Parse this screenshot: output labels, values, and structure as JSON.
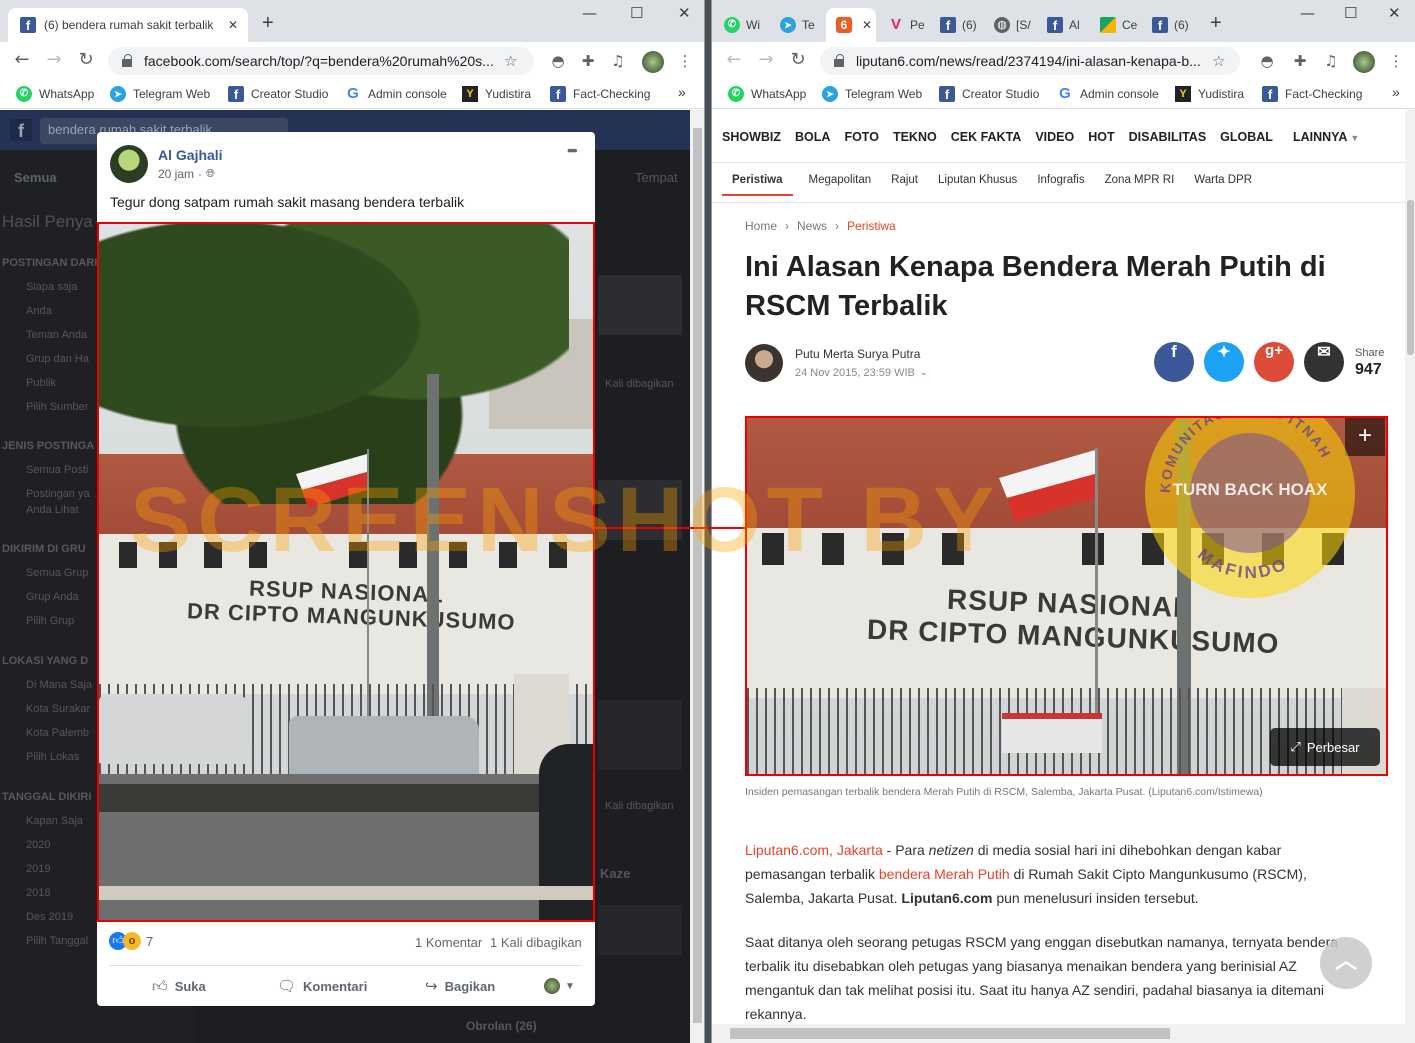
{
  "left_window": {
    "tab": {
      "title": "(6) bendera rumah sakit terbalik",
      "close": "✕"
    },
    "new_tab": "+",
    "window_controls": [
      "—",
      "☐",
      "✕"
    ],
    "url": "facebook.com/search/top/?q=bendera%20rumah%20s...",
    "bookmarks": [
      "WhatsApp",
      "Telegram Web",
      "Creator Studio",
      "Admin console",
      "Yudistira",
      "Fact-Checking"
    ],
    "bookmarks_more": "»",
    "fb_search_text": "bendera rumah sakit terbalik",
    "fb_tab_all": "Semua",
    "fb_places": "Tempat",
    "fb_results_title": "Hasil Penya",
    "fb_sidebar": [
      "POSTINGAN DARI",
      "Siapa saja",
      "Anda",
      "Teman Anda",
      "Grup dan Ha",
      "Publik",
      "Pilih Sumber",
      "JENIS POSTINGA",
      "Semua Posti",
      "Postingan ya",
      "Anda Lihat",
      "DIKIRIM DI GRU",
      "Semua Grup",
      "Grup Anda",
      "Pilih Grup",
      "LOKASI YANG D",
      "Di Mana Saja",
      "Kota Surakar",
      "Kota Palemb",
      "Pilih Lokas",
      "TANGGAL DIKIRI",
      "Kapan Saja",
      "2020",
      "2019",
      "2018",
      "Des 2019",
      "Pilih Tanggal"
    ],
    "fb_right_snippets": [
      "Kali dibagikan",
      "Kali dibagikan",
      "Kaze",
      "Obrolan (26)"
    ],
    "post": {
      "author": "Al Gajhali",
      "time": "20 jam",
      "text": "Tegur dong satpam rumah sakit masang bendera terbalik",
      "reaction_count": "7",
      "comments": "1 Komentar",
      "shares": "1 Kali dibagikan",
      "like_label": "Suka",
      "comment_label": "Komentari",
      "share_label": "Bagikan",
      "menu": "•••"
    }
  },
  "right_window": {
    "tabs": [
      "Wi",
      "Te",
      "Pe",
      "(6)",
      "[S/",
      "Al",
      "Ce",
      "(6)"
    ],
    "close": "✕",
    "new_tab": "+",
    "window_controls": [
      "—",
      "☐",
      "✕"
    ],
    "url": "liputan6.com/news/read/2374194/ini-alasan-kenapa-b...",
    "bookmarks": [
      "WhatsApp",
      "Telegram Web",
      "Creator Studio",
      "Admin console",
      "Yudistira",
      "Fact-Checking"
    ],
    "bookmarks_more": "»",
    "nav_main": [
      "SHOWBIZ",
      "BOLA",
      "FOTO",
      "TEKNO",
      "CEK FAKTA",
      "VIDEO",
      "HOT",
      "DISABILITAS",
      "GLOBAL",
      "LAINNYA"
    ],
    "nav_sub": [
      "Peristiwa",
      "Megapolitan",
      "Rajut",
      "Liputan Khusus",
      "Infografis",
      "Zona MPR RI",
      "Warta DPR"
    ],
    "breadcrumb": [
      "Home",
      "News",
      "Peristiwa"
    ],
    "headline_line1": "Ini Alasan Kenapa Bendera Merah Putih di",
    "headline_line2": "RSCM Terbalik",
    "author": "Putu Merta Surya Putra",
    "date": "24 Nov 2015, 23:59 WIB",
    "share_label": "Share",
    "share_count": "947",
    "photo_enlarge": "Perbesar",
    "caption": "Insiden pemasangan terbalik bendera Merah Putih di RSCM, Salemba, Jakarta Pusat. (Liputan6.com/Istimewa)",
    "p1_source": "Liputan6.com, Jakarta",
    "p1_a": " - Para ",
    "p1_netizen": "netizen",
    "p1_b": " di media sosial hari ini dihebohkan dengan kabar pemasangan terbalik ",
    "p1_link": "bendera Merah Putih",
    "p1_c": " di Rumah Sakit Cipto Mangunkusumo (RSCM), Salemba, Jakarta Pusat. ",
    "p1_bold": "Liputan6.com",
    "p1_d": " pun menelusuri insiden tersebut.",
    "p2": "Saat ditanya oleh seorang petugas RSCM yang enggan disebutkan namanya, ternyata bendera terbalik itu disebabkan oleh petugas yang biasanya menaikan bendera yang berinisial AZ mengantuk dan tak melihat posisi itu. Saat itu hanya AZ sendiri, padahal biasanya ia ditemani rekannya."
  },
  "photo_sign": {
    "line1": "RSUP NASIONAL",
    "line2": "DR CIPTO MANGUNKUSUMO"
  },
  "watermark": "SCREENSHOT BY",
  "stamp": {
    "top": "KOMUNITAS ANTI FITNAH",
    "mid": "TURN BACK HOAX",
    "bottom": "MAFINDO"
  },
  "colors": {
    "fb_blue": "#3b5998",
    "liputan_red": "#e8442c",
    "highlight_red": "#e00000"
  }
}
